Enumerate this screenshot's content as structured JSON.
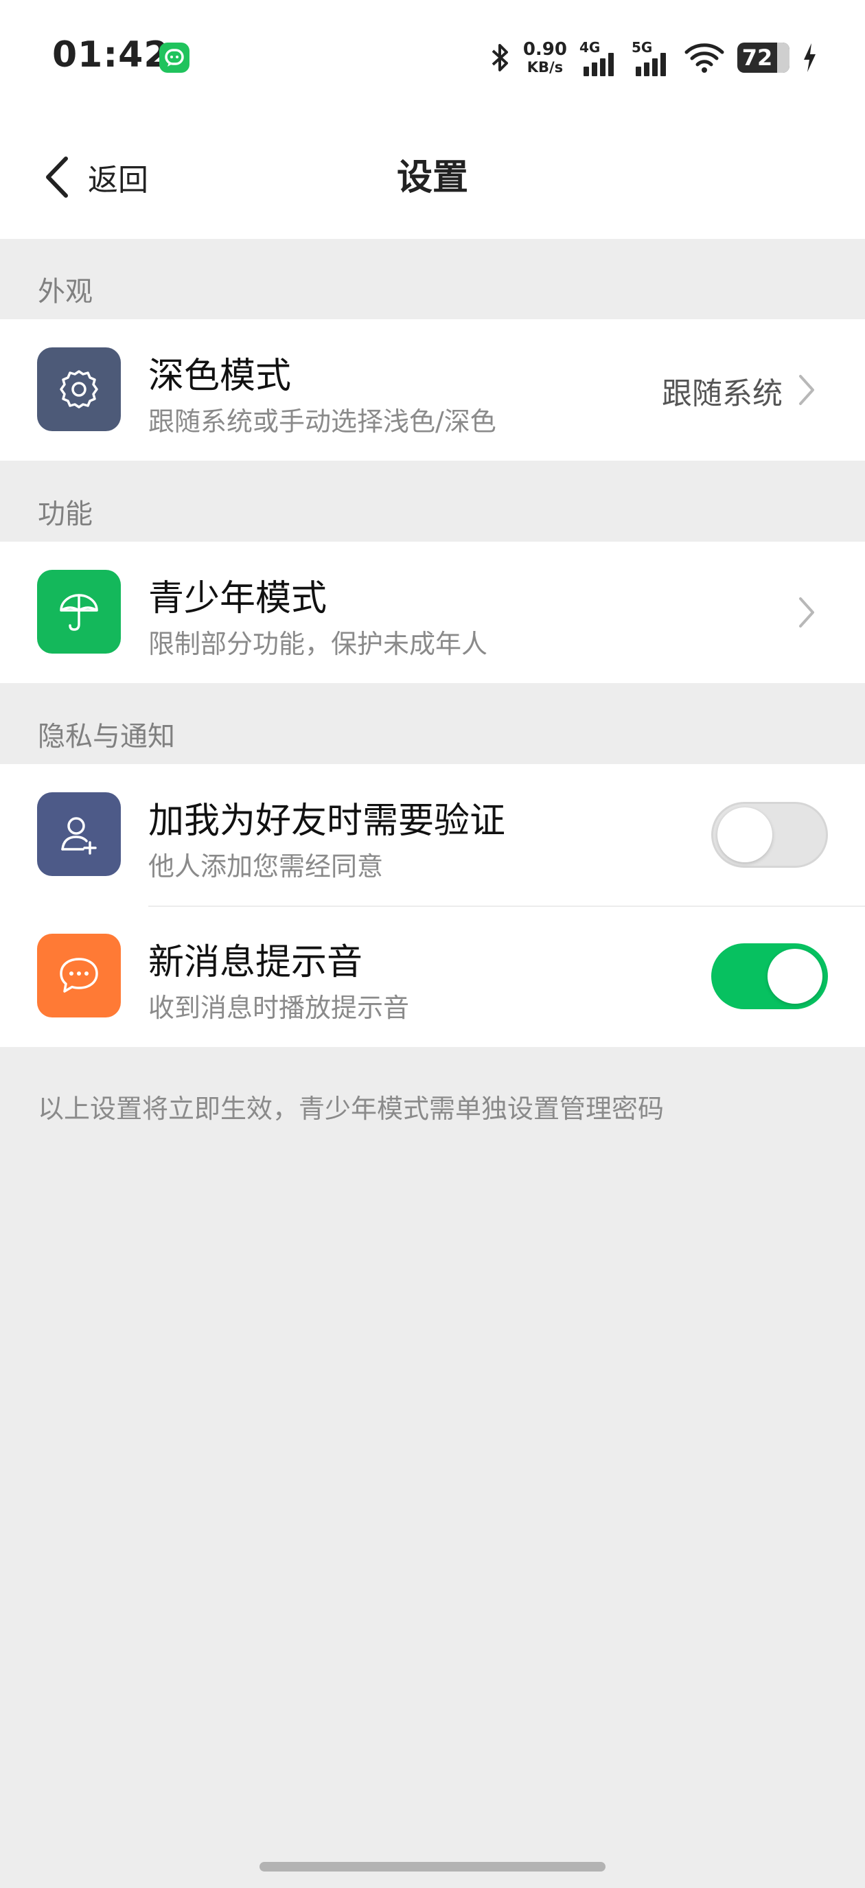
{
  "status_bar": {
    "time": "01:42",
    "app_icon": "chat-bubble-icon",
    "bluetooth_icon": "bluetooth-icon",
    "net_speed_value": "0.90",
    "net_speed_unit": "KB/s",
    "sim1_label": "4G",
    "sim2_label": "5G",
    "wifi_icon": "wifi-icon",
    "battery_percent": "72",
    "charging_icon": "charging-bolt-icon"
  },
  "nav": {
    "back_label": "返回",
    "title": "设置"
  },
  "sections": {
    "appearance": {
      "header": "外观",
      "dark_mode": {
        "title": "深色模式",
        "subtitle": "跟随系统或手动选择浅色/深色",
        "value": "跟随系统",
        "icon": "gear-icon",
        "icon_color": "#4d5a78"
      }
    },
    "features": {
      "header": "功能",
      "youth_mode": {
        "title": "青少年模式",
        "subtitle": "限制部分功能，保护未成年人",
        "icon": "umbrella-icon",
        "icon_color": "#14b85b"
      }
    },
    "privacy": {
      "header": "隐私与通知",
      "friend_verify": {
        "title": "加我为好友时需要验证",
        "subtitle": "他人添加您需经同意",
        "icon": "add-user-icon",
        "icon_color": "#4d5a88",
        "enabled": false
      },
      "message_sound": {
        "title": "新消息提示音",
        "subtitle": "收到消息时播放提示音",
        "icon": "message-dots-icon",
        "icon_color": "#ff7a35",
        "enabled": true
      }
    }
  },
  "footnote": "以上设置将立即生效，青少年模式需单独设置管理密码",
  "colors": {
    "accent_green": "#07c160",
    "page_bg": "#ededed",
    "card_bg": "#ffffff"
  }
}
